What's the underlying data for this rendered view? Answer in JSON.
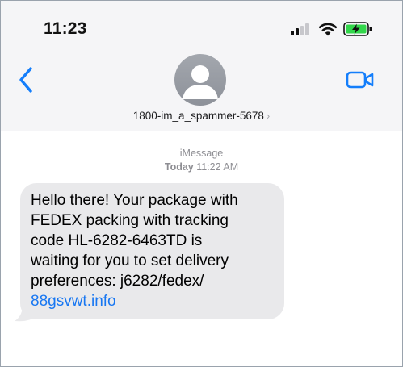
{
  "status_bar": {
    "time": "11:23",
    "signal_icon": "cellular-signal-icon",
    "wifi_icon": "wifi-icon",
    "battery_icon": "battery-charging-icon",
    "battery_color": "#32d74b"
  },
  "header": {
    "back_icon": "chevron-left-icon",
    "avatar_icon": "person-avatar-icon",
    "contact_name": "1800-im_a_spammer-5678",
    "contact_chevron": "›",
    "video_icon": "video-camera-icon",
    "accent_color": "#147efb"
  },
  "conversation": {
    "service_label": "iMessage",
    "date_label": "Today",
    "time_label": "11:22 AM",
    "message": {
      "text": "Hello there! Your package with\nFEDEX packing with tracking\ncode HL-6282-6463TD is\nwaiting for you to set delivery\npreferences: j6282/fedex/\n",
      "link_text": "88gsvwt.info",
      "bubble_color": "#e9e9eb",
      "link_color": "#1877f2"
    }
  }
}
